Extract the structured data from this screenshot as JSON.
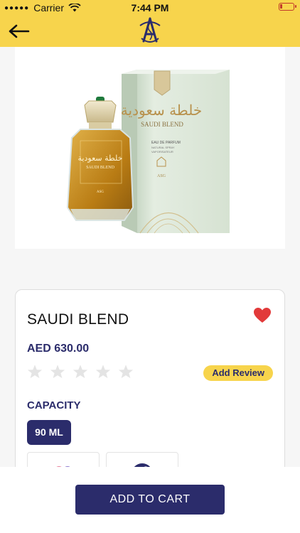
{
  "status": {
    "carrier": "Carrier",
    "time": "7:44 PM"
  },
  "header": {
    "back_icon": "arrow-left-icon",
    "logo": "brand-logo"
  },
  "product": {
    "image": "perfume-bottle-and-box",
    "image_text": {
      "arabic_name": "خلطة سعودية",
      "name": "SAUDI BLEND",
      "type": "EAU DE PARFUM",
      "spray": "NATURAL SPRAY",
      "spray2": "VAPORISATEUR",
      "brand": "ASG"
    },
    "name": "SAUDI BLEND",
    "price": "AED 630.00",
    "favorite_icon": "heart-icon",
    "rating": 0,
    "max_rating": 5,
    "add_review_label": "Add Review",
    "capacity_label": "CAPACITY",
    "capacity_options": [
      "90 ML"
    ],
    "selected_capacity": "90 ML"
  },
  "footer": {
    "cart_label": "ADD TO CART"
  },
  "colors": {
    "accent": "#f7d44c",
    "brand": "#2b2c6b",
    "heart": "#e23a3a",
    "background": "#f6f6f6"
  }
}
